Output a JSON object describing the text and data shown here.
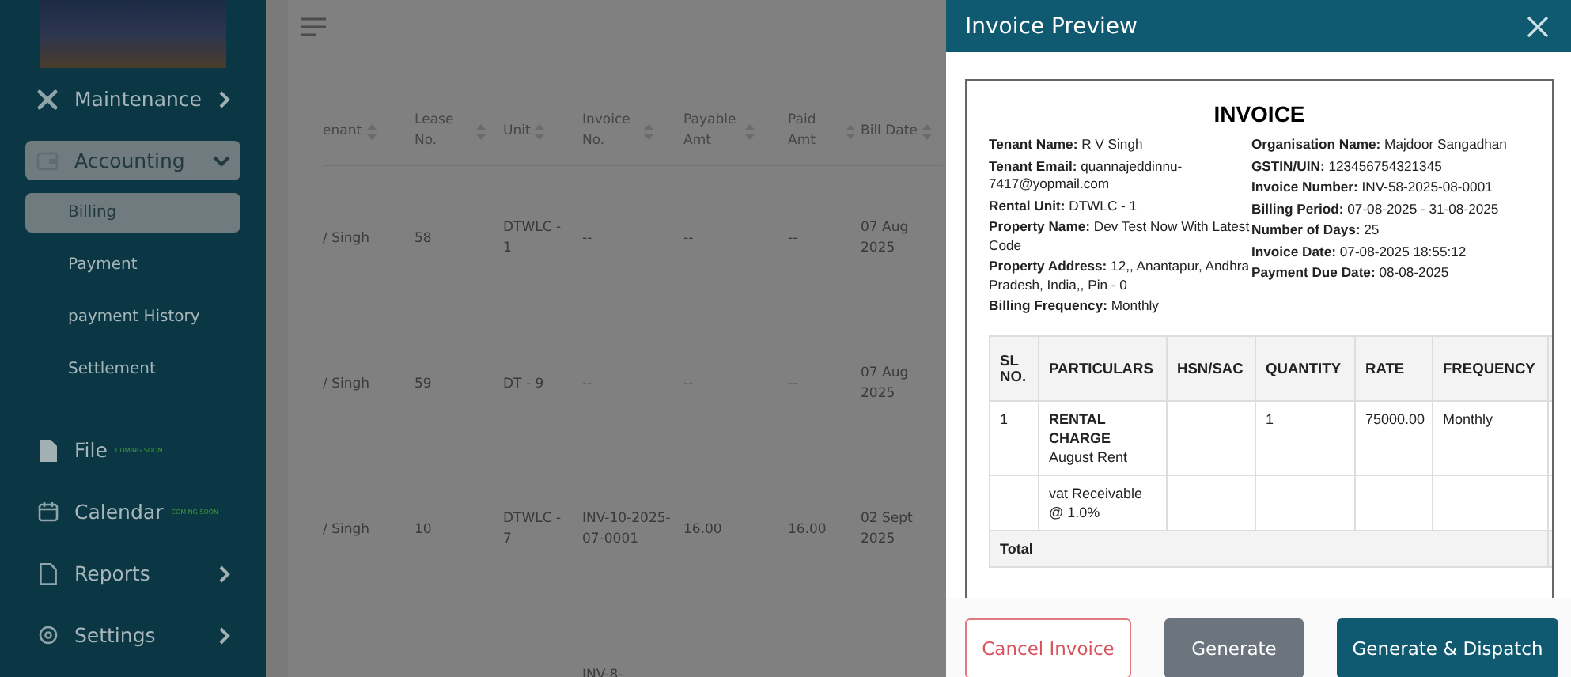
{
  "sidebar": {
    "items": [
      {
        "label": "Maintenance",
        "selected": false,
        "expanded": false
      },
      {
        "label": "Accounting",
        "selected": true,
        "expanded": true,
        "children": [
          {
            "label": "Billing",
            "selected": true
          },
          {
            "label": "Payment",
            "selected": false
          },
          {
            "label": "payment History",
            "selected": false
          },
          {
            "label": "Settlement",
            "selected": false
          }
        ]
      },
      {
        "label": "File",
        "selected": false,
        "badge": "COMING SOON"
      },
      {
        "label": "Calendar",
        "selected": false,
        "badge": "COMING SOON"
      },
      {
        "label": "Reports",
        "selected": false,
        "expanded": false
      },
      {
        "label": "Settings",
        "selected": false,
        "expanded": false
      }
    ]
  },
  "table": {
    "columns": [
      "enant",
      "Lease No.",
      "Unit",
      "Invoice No.",
      "Payable Amt",
      "Paid Amt",
      "Bill Date"
    ],
    "rows": [
      [
        "/ Singh",
        "58",
        "DTWLC - 1",
        "--",
        "--",
        "--",
        "07 Aug 2025"
      ],
      [
        "/ Singh",
        "59",
        "DT - 9",
        "--",
        "--",
        "--",
        "07 Aug 2025"
      ],
      [
        "/ Singh",
        "10",
        "DTWLC - 7",
        "INV-10-2025-07-0001",
        "16.00",
        "16.00",
        "02 Sept 2025"
      ],
      [
        null,
        null,
        null,
        "INV-8-",
        null,
        null,
        null
      ]
    ]
  },
  "drawer": {
    "title": "Invoice Preview",
    "invoice": {
      "title": "INVOICE",
      "left_fields": [
        "**Tenant Name:** R V Singh",
        "**Tenant Email:** quannajeddinnu-7417@yopmail.com",
        "**Rental Unit:** DTWLC - 1",
        "**Property Name:** Dev Test Now With Latest Code",
        "**Property Address:** 12,, Anantapur, Andhra Pradesh, India,, Pin - 0",
        "**Billing Frequency:** Monthly"
      ],
      "right_fields": [
        "**Organisation Name:** Majdoor Sangadhan",
        "**GSTIN/UIN:** 123456754321345",
        "**Invoice Number:** INV-58-2025-08-0001",
        "**Billing Period:** 07-08-2025 - 31-08-2025",
        "**Number of Days:** 25",
        "**Invoice Date:** 07-08-2025 18:55:12",
        "**Payment Due Date:** 08-08-2025"
      ],
      "columns": [
        "SL NO.",
        "PARTICULARS",
        "HSN/SAC",
        "QUANTITY",
        "RATE",
        "FREQUENCY"
      ],
      "rows": [
        {
          "kind": "item",
          "cells": [
            "1",
            "",
            "",
            "1",
            "75000.00",
            "Monthly"
          ],
          "title": "RENTAL CHARGE",
          "subtitle": "August Rent"
        },
        {
          "kind": "item",
          "cells": [
            "",
            "",
            "",
            "",
            "",
            ""
          ],
          "subtitle": "vat Receivable @ 1.0%"
        },
        {
          "kind": "total",
          "label": "Total"
        }
      ]
    },
    "buttons": [
      {
        "label": "Cancel Invoice",
        "kind": "danger"
      },
      {
        "label": "Generate",
        "kind": "secondary"
      },
      {
        "label": "Generate & Dispatch",
        "kind": "primary"
      }
    ]
  }
}
